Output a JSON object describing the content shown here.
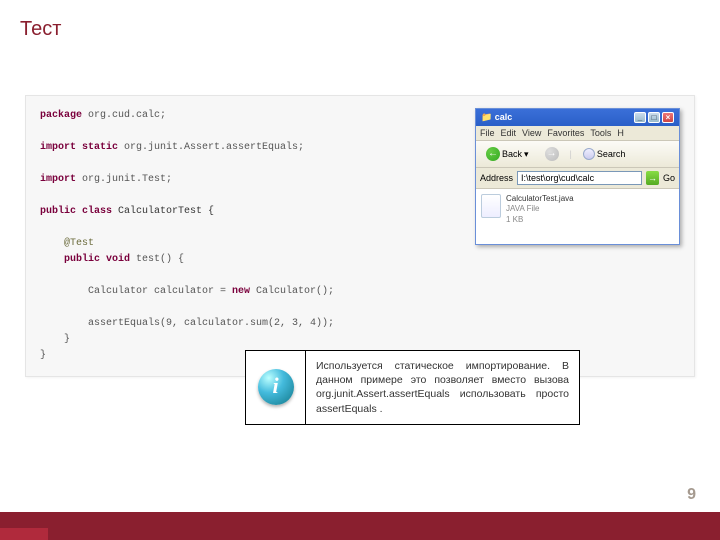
{
  "title": "Тест",
  "page_number": "9",
  "code": {
    "package_kw": "package",
    "package_name": " org.cud.calc;",
    "import_static_kw": "import static",
    "import_static_rest": " org.junit.Assert.assertEquals;",
    "import_kw": "import",
    "import_rest": " org.junit.Test;",
    "class_decl_kw": "public class",
    "class_name": " CalculatorTest {",
    "annotation": "@Test",
    "method_kw": "public void",
    "method_name": " test() {",
    "stmt1_a": "Calculator calculator = ",
    "stmt1_new": "new",
    "stmt1_b": " Calculator();",
    "stmt2": "assertEquals(9, calculator.sum(2, 3, 4));",
    "close_method": "}",
    "close_class": "}"
  },
  "explorer": {
    "title_icon": "📁",
    "title": "calc",
    "win_min": "_",
    "win_max": "□",
    "win_close": "×",
    "menu": {
      "file": "File",
      "edit": "Edit",
      "view": "View",
      "fav": "Favorites",
      "tools": "Tools",
      "help": "H"
    },
    "back_label": "Back",
    "back_glyph": "←",
    "fwd_glyph": "→",
    "search_label": "Search",
    "address_label": "Address",
    "address_value": "I:\\test\\org\\cud\\calc",
    "go_glyph": "→",
    "go_label": "Go",
    "file": {
      "name": "CalculatorTest.java",
      "type": "JAVA File",
      "size": "1 KB"
    }
  },
  "callout": {
    "text": "Используется статическое импортирование. В данном примере это позволяет вместо вызова org.junit.Assert.assertEquals использовать просто assertEquals ."
  }
}
